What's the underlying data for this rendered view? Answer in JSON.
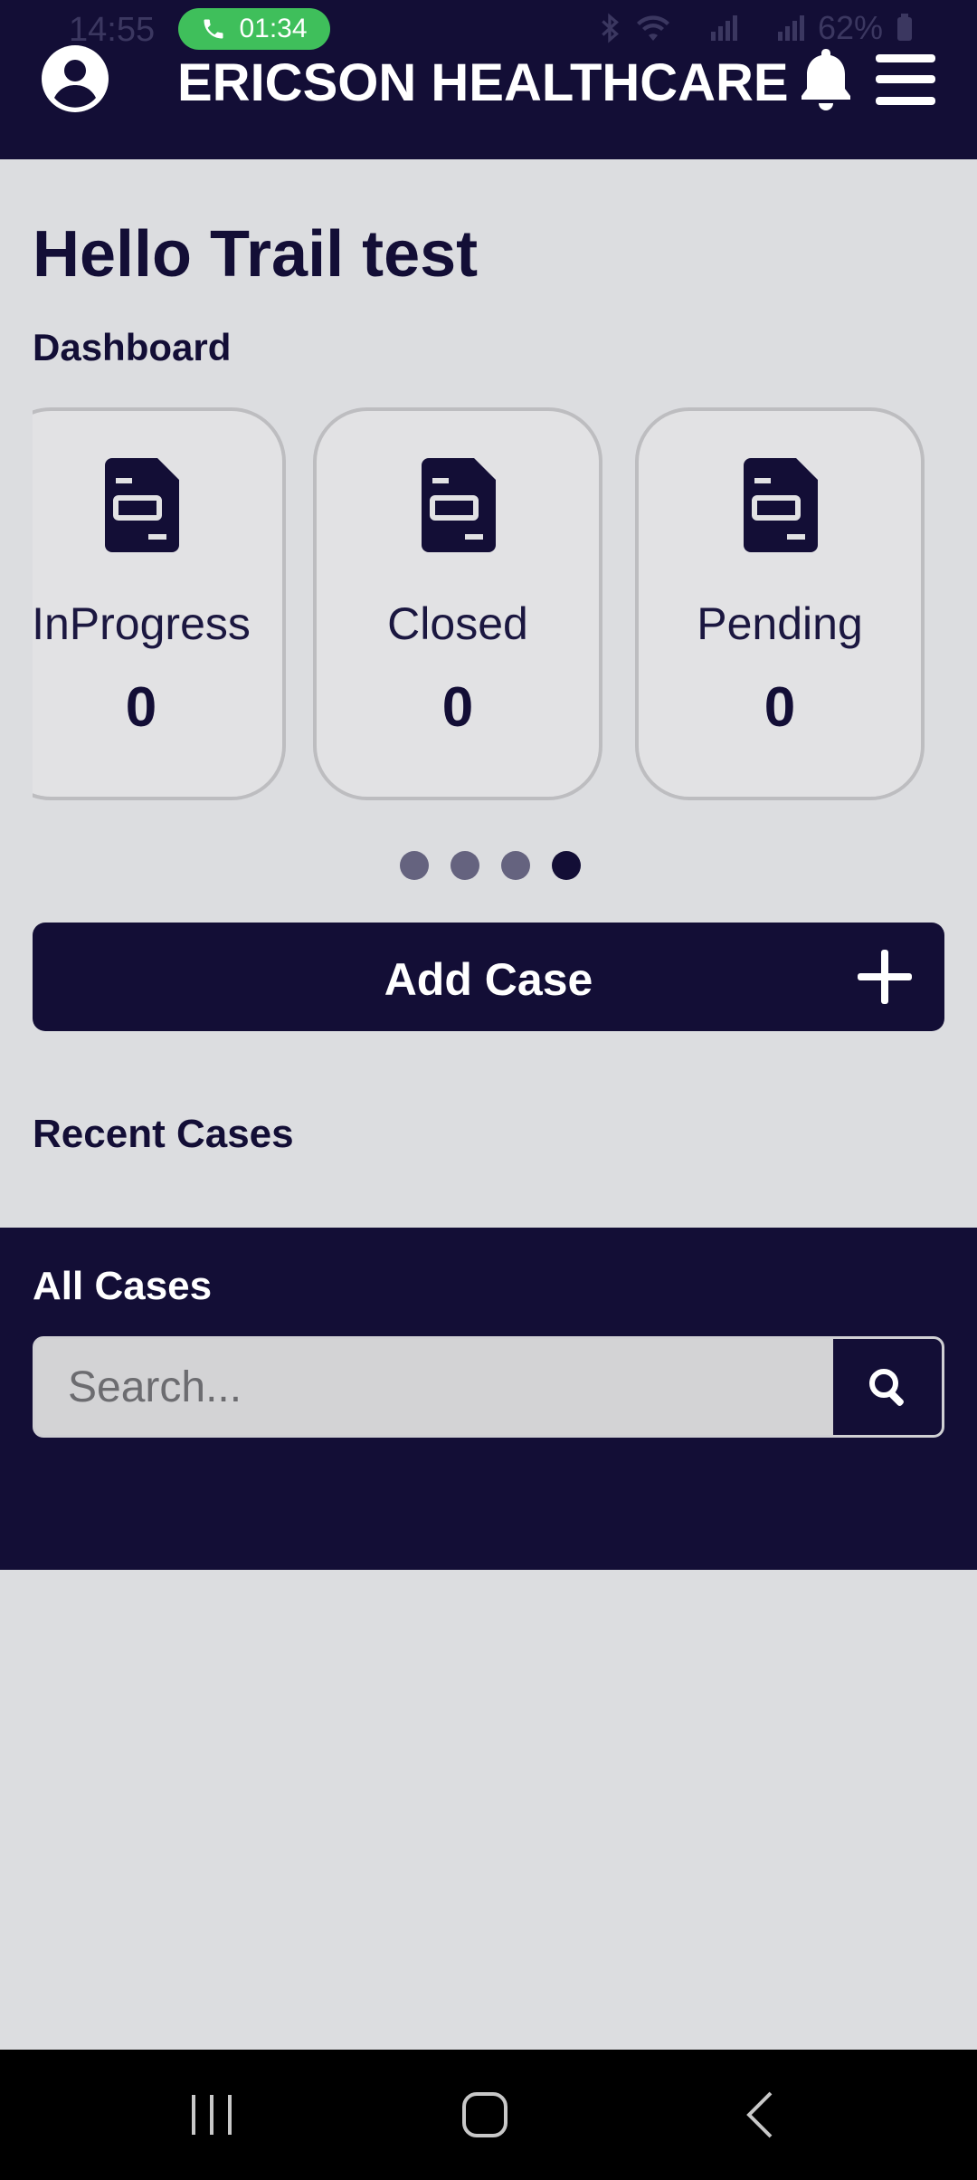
{
  "status_bar": {
    "time": "14:55",
    "call_duration": "01:34",
    "battery": "62%"
  },
  "header": {
    "app_title": "ERICSON HEALTHCARE",
    "profile_icon": "account-circle-icon",
    "notification_icon": "bell-icon",
    "menu_icon": "hamburger-menu-icon"
  },
  "greeting": "Hello Trail test",
  "dashboard": {
    "title": "Dashboard",
    "cards": [
      {
        "label": "InProgress",
        "count": "0",
        "icon": "document-icon"
      },
      {
        "label": "Closed",
        "count": "0",
        "icon": "document-icon"
      },
      {
        "label": "Pending",
        "count": "0",
        "icon": "document-icon"
      }
    ],
    "pager": {
      "total": 4,
      "active": 4
    }
  },
  "add_case": {
    "label": "Add Case",
    "icon": "plus-icon"
  },
  "recent_cases": {
    "title": "Recent Cases"
  },
  "all_cases": {
    "title": "All Cases",
    "search_placeholder": "Search...",
    "search_icon": "search-icon"
  },
  "nav": {
    "recent_icon": "recent-apps-icon",
    "home_icon": "home-icon",
    "back_icon": "back-icon"
  },
  "colors": {
    "primary": "#130e36",
    "background": "#dcdde0",
    "card": "#e2e2e4",
    "call_pill": "#3fbf5b"
  }
}
